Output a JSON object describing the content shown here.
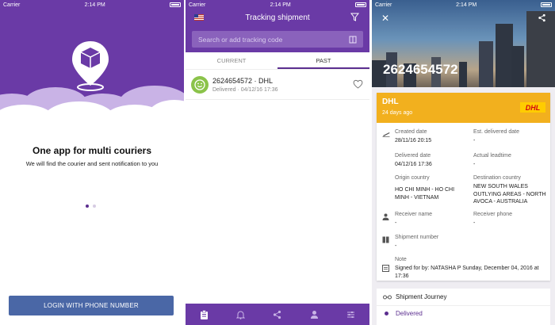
{
  "status_bar": {
    "carrier": "Carrier",
    "time": "2:14 PM"
  },
  "onboarding": {
    "title": "One app for multi couriers",
    "subtitle": "We will find the courier and sent notification to you",
    "login_label": "LOGIN WITH PHONE NUMBER",
    "page_index": 1,
    "page_count": 2
  },
  "tracking": {
    "header_title": "Tracking shipment",
    "search_placeholder": "Search or add tracking code",
    "tabs": [
      {
        "label": "CURRENT"
      },
      {
        "label": "PAST"
      }
    ],
    "active_tab": "PAST",
    "items": [
      {
        "title": "2624654572 · DHL",
        "subtitle": "Delivered · 04/12/16 17:36",
        "favorite": false
      }
    ]
  },
  "detail": {
    "number": "2624654572",
    "courier": "DHL",
    "ago": "24 days ago",
    "logo_text": "DHL",
    "created_label": "Created date",
    "created_value": "28/11/16 20:15",
    "est_label": "Est. delivered date",
    "est_value": "-",
    "delivered_label": "Delivered date",
    "delivered_value": "04/12/16 17:36",
    "leadtime_label": "Actual leadtime",
    "leadtime_value": "-",
    "origin_label": "Origin country",
    "origin_value": "HO CHI MINH - HO CHI MINH - VIETNAM",
    "dest_label": "Destination country",
    "dest_value": "NEW SOUTH WALES OUTLYING AREAS - NORTH AVOCA - AUSTRALIA",
    "receiver_label": "Receiver name",
    "receiver_value": "-",
    "phone_label": "Receiver phone",
    "phone_value": "-",
    "shipnum_label": "Shipment number",
    "shipnum_value": "-",
    "note_label": "Note",
    "note_value": "Signed for by: NATASHA P  Sunday, December 04, 2016 at 17:36",
    "journey_title": "Shipment Journey",
    "journey_status": "Delivered"
  },
  "colors": {
    "primary": "#6a3aa6",
    "button": "#4a67a6",
    "dhl_bar": "#f2b01e",
    "avatar": "#8bc34a"
  }
}
